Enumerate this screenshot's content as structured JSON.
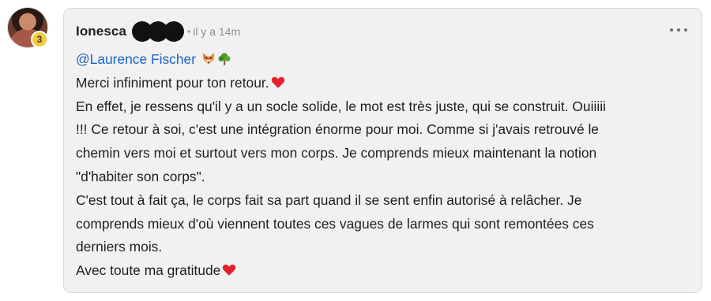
{
  "comment": {
    "author": "Ionesca",
    "time_separator": "•",
    "time": "il y a 14m",
    "level_badge": "3",
    "mention": "@Laurence Fischer",
    "mention_emojis": [
      "fox-emoji",
      "tree-emoji"
    ],
    "lines": [
      "Merci infiniment pour ton retour.",
      "En effet, je ressens qu'il y a un socle solide, le mot est très juste, qui se construit. Ouiiiii",
      "!!! Ce retour à soi, c'est une intégration énorme pour moi. Comme si j'avais retrouvé le",
      "chemin vers moi et surtout vers mon corps. Je comprends mieux maintenant la notion",
      "\"d'habiter son corps\".",
      "C'est tout à fait ça, le corps fait sa part quand il se sent enfin autorisé à relâcher. Je",
      "comprends mieux d'où viennent toutes ces vagues de larmes qui sont remontées ces",
      "derniers mois.",
      "Avec toute ma gratitude"
    ],
    "heart_emoji": "heart-emoji"
  },
  "colors": {
    "card_background": "#f1f1f1",
    "mention": "#1a63c5",
    "heart": "#e5202e",
    "badge": "#f4c93b"
  }
}
